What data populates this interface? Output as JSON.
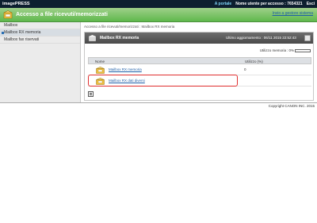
{
  "header": {
    "brand": "imagePRESS",
    "portal_link": "A portale",
    "user_label": "Nome utente per accesso : 7654321",
    "exit_label": "Esci"
  },
  "titlebar": {
    "title": "Accesso a file ricevuti/memorizzati",
    "tools_link": "Invio a gestore sistema"
  },
  "sidebar": {
    "items": [
      {
        "label": "Mailbox"
      },
      {
        "label": "Mailbox RX memoria"
      },
      {
        "label": "Mailbox fax riservati"
      }
    ]
  },
  "main": {
    "breadcrumb": "Accesso a file ricevuti/memorizzati : Mailbox RX memoria",
    "panel": {
      "title": "Mailbox RX memoria",
      "last_update": "Ultimo aggiornamento : 06/11 2015 22:52:43",
      "usage_label": "Utilizzo memoria :",
      "usage_value": "0%",
      "usage_fraction": 0
    },
    "table": {
      "col_name": "Nome",
      "col_usage": "Utilizzo (%)",
      "rows": [
        {
          "name": "Mailbox RX memoria",
          "usage": "0"
        },
        {
          "name": "Mailbox RX dati diversi",
          "usage": ""
        }
      ]
    }
  },
  "footer": {
    "copyright": "Copyright CANON INC. 2015"
  },
  "colors": {
    "topbar": "#0d1f2f",
    "titlebar": "#5fb84c",
    "link": "#1f5fa8",
    "highlight": "#e03030"
  }
}
